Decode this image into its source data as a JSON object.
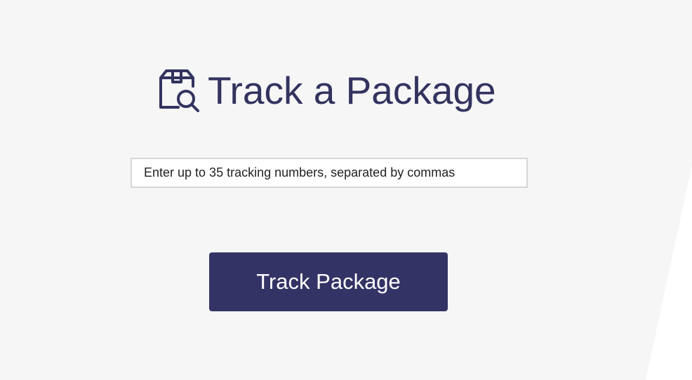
{
  "header": {
    "title": "Track a Package",
    "icon": "package-search-icon"
  },
  "search": {
    "placeholder": "Enter up to 35 tracking numbers, separated by commas",
    "value": ""
  },
  "actions": {
    "track_label": "Track Package"
  },
  "colors": {
    "brand": "#343365",
    "background": "#f6f6f7",
    "input_border": "#d6d6d8"
  }
}
